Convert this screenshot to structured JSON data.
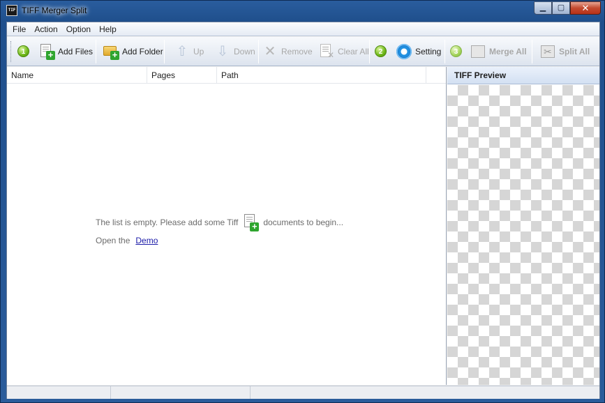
{
  "window": {
    "title": "TIFF Merger Split",
    "icon_text": "TIF"
  },
  "menu": [
    "File",
    "Action",
    "Option",
    "Help"
  ],
  "toolbar": {
    "step1": "1",
    "add_files": "Add Files",
    "add_folder": "Add Folder",
    "up": "Up",
    "down": "Down",
    "remove": "Remove",
    "clear_all": "Clear All",
    "step2": "2",
    "setting": "Setting",
    "step3": "3",
    "merge_all": "Merge All",
    "split_all": "Split All"
  },
  "list": {
    "columns": [
      "Name",
      "Pages",
      "Path"
    ],
    "empty_text_before": "The list is empty. Please add some Tiff",
    "empty_text_after": "documents to begin...",
    "open_the": "Open the",
    "demo_link": "Demo"
  },
  "preview": {
    "title": "TIFF Preview"
  },
  "icons": {
    "app": "tif-app-icon",
    "add_files": "add-file-icon",
    "add_folder": "add-folder-icon",
    "up": "up-arrow-icon",
    "down": "down-arrow-icon",
    "remove": "x-icon",
    "clear_all": "clear-all-icon",
    "setting": "gear-icon",
    "merge_all": "merge-icon",
    "split_all": "split-icon"
  }
}
